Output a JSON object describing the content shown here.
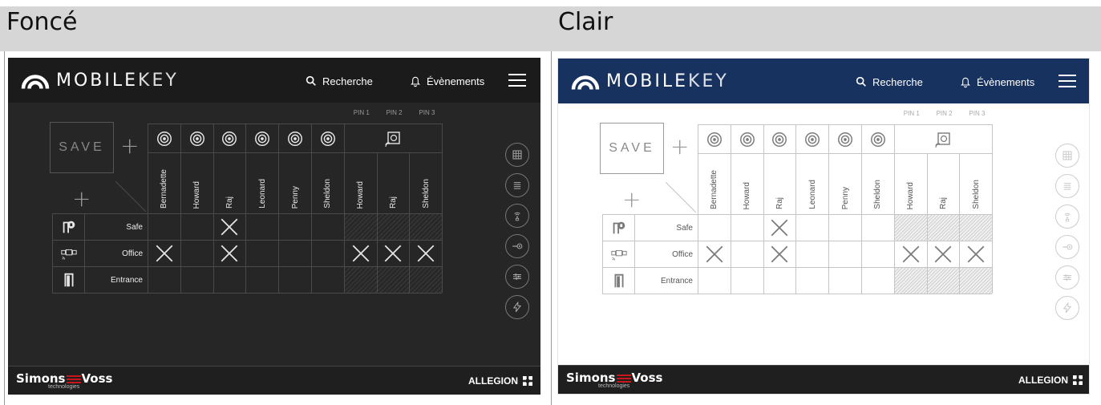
{
  "columns": [
    {
      "title": "Foncé",
      "theme": "dark"
    },
    {
      "title": "Clair",
      "theme": "light"
    }
  ],
  "app": {
    "brand": {
      "bold": "MOBILE",
      "thin": "KEY"
    },
    "search_label": "Recherche",
    "events_label": "Évènements",
    "save_label": "SAVE",
    "pin_labels": [
      "PIN 1",
      "PIN 2",
      "PIN 3"
    ],
    "people": [
      "Bernadette",
      "Howard",
      "Raj",
      "Leonard",
      "Penny",
      "Sheldon",
      "Howard",
      "Raj",
      "Sheldon"
    ],
    "doors": [
      {
        "name": "Safe",
        "icon": "safe-lock-icon",
        "marks": [
          false,
          false,
          true,
          false,
          false,
          false,
          false,
          false,
          false
        ]
      },
      {
        "name": "Office",
        "icon": "door-reader-icon",
        "marks": [
          true,
          false,
          true,
          false,
          false,
          false,
          true,
          true,
          true
        ]
      },
      {
        "name": "Entrance",
        "icon": "door-icon",
        "marks": [
          false,
          false,
          false,
          false,
          false,
          false,
          false,
          false,
          false
        ]
      }
    ],
    "hatched": [
      [
        false,
        false,
        false,
        false,
        false,
        false,
        true,
        true,
        true
      ],
      [
        false,
        false,
        false,
        false,
        false,
        false,
        false,
        false,
        false
      ],
      [
        false,
        false,
        false,
        false,
        false,
        false,
        true,
        true,
        true
      ]
    ],
    "side_icons": [
      "grid-icon",
      "list-icon",
      "wireless-icon",
      "key-at-icon",
      "sliders-icon",
      "lightning-icon"
    ],
    "footer": {
      "simons": "Simons",
      "voss": "Voss",
      "tech": "technologies",
      "allegion": "ALLEGION"
    }
  },
  "colors": {
    "dark_bg": "#262626",
    "light_header": "#17325f",
    "accent_red": "#c8161d"
  }
}
